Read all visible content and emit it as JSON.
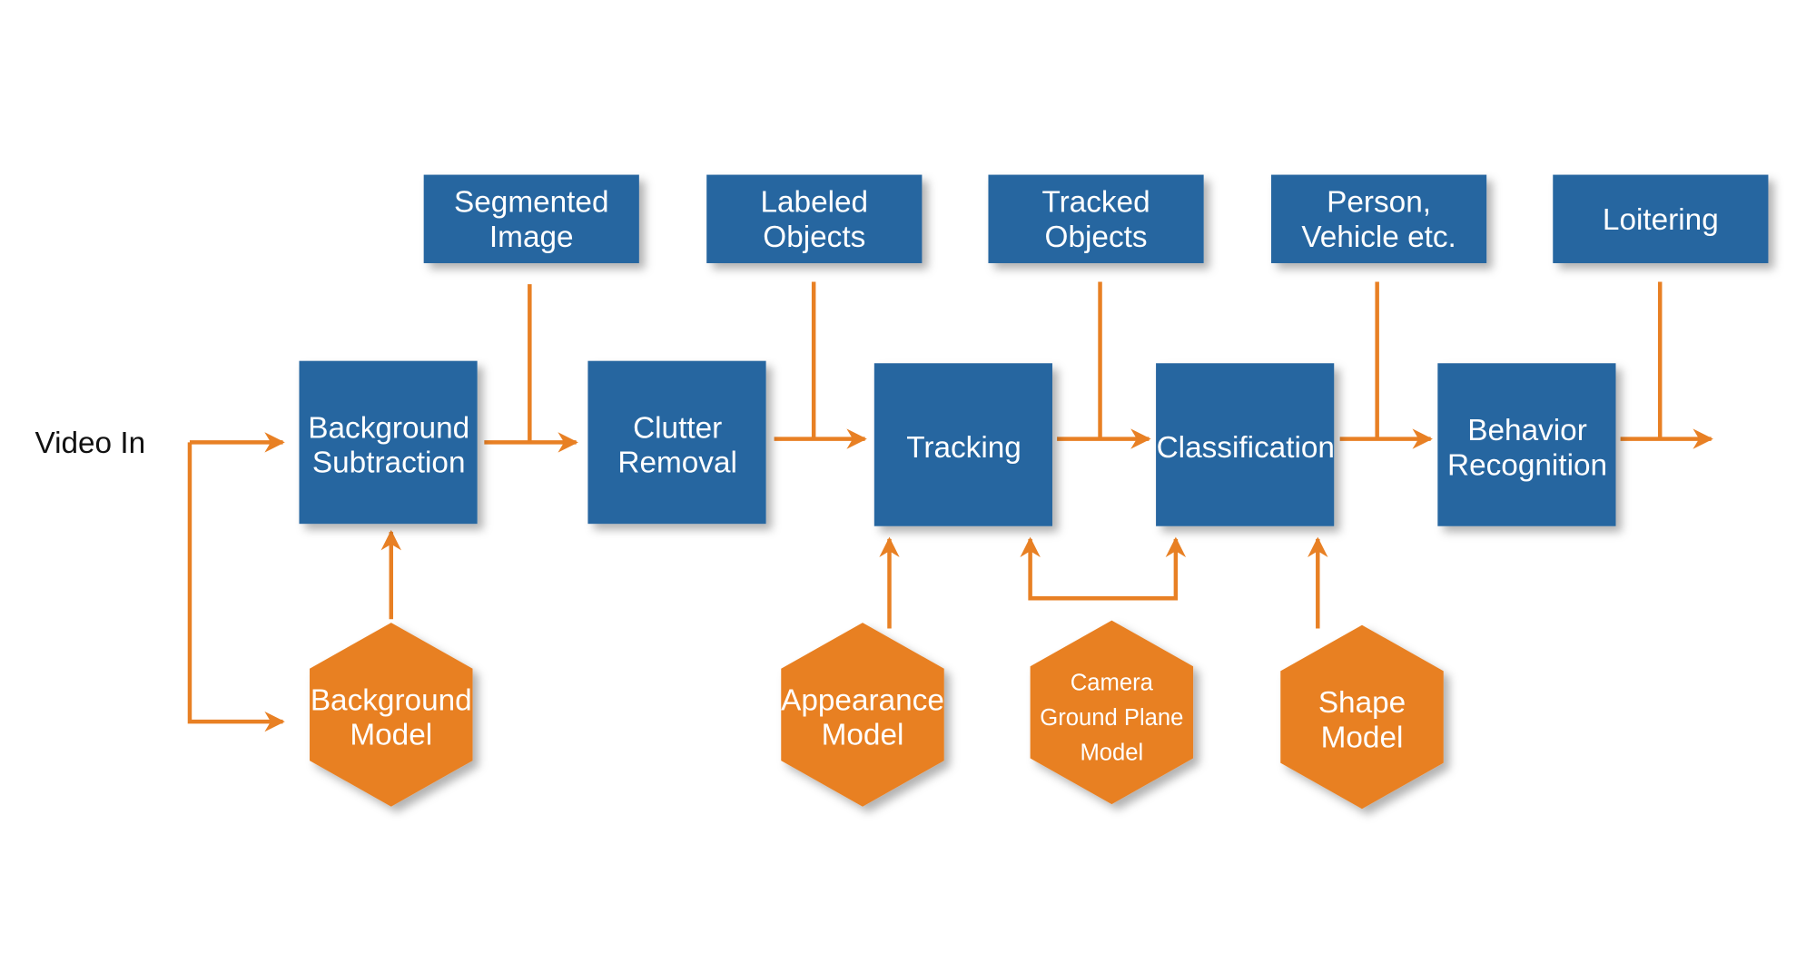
{
  "colors": {
    "process_box": "#2866a0",
    "model_hexagon": "#e88024",
    "arrow": "#e88024"
  },
  "input_label": "Video In",
  "outputs": [
    {
      "lines": [
        "Segmented",
        "Image"
      ]
    },
    {
      "lines": [
        "Labeled",
        "Objects"
      ]
    },
    {
      "lines": [
        "Tracked",
        "Objects"
      ]
    },
    {
      "lines": [
        "Person,",
        "Vehicle etc."
      ]
    },
    {
      "lines": [
        "Loitering"
      ]
    }
  ],
  "processes": [
    {
      "lines": [
        "Background",
        "Subtraction"
      ]
    },
    {
      "lines": [
        "Clutter",
        "Removal"
      ]
    },
    {
      "lines": [
        "Tracking"
      ]
    },
    {
      "lines": [
        "Classification"
      ]
    },
    {
      "lines": [
        "Behavior",
        "Recognition"
      ]
    }
  ],
  "models": [
    {
      "lines": [
        "Background",
        "Model"
      ]
    },
    {
      "lines": [
        "Appearance",
        "Model"
      ]
    },
    {
      "lines": [
        "Camera",
        "Ground Plane",
        "Model"
      ]
    },
    {
      "lines": [
        "Shape",
        "Model"
      ]
    }
  ]
}
